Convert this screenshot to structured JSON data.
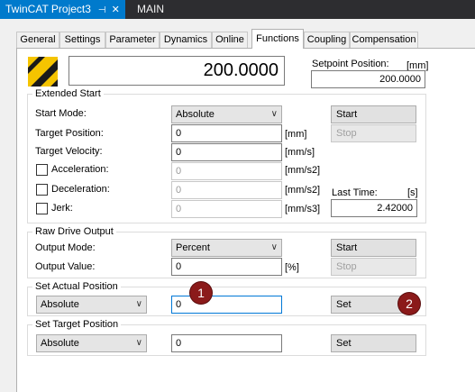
{
  "doc_tabs": [
    {
      "label": "TwinCAT Project3",
      "pin": "⊣",
      "close": "✕"
    },
    {
      "label": "MAIN"
    }
  ],
  "tabs": [
    "General",
    "Settings",
    "Parameter",
    "Dynamics",
    "Online",
    "Functions",
    "Coupling",
    "Compensation"
  ],
  "selected_tab": "Functions",
  "display": {
    "value": "200.0000"
  },
  "setpoint": {
    "label": "Setpoint Position:",
    "unit": "[mm]",
    "value": "200.0000"
  },
  "extended_start": {
    "title": "Extended Start",
    "start_mode_label": "Start Mode:",
    "start_mode_value": "Absolute",
    "start_button": "Start",
    "target_position_label": "Target Position:",
    "target_position_value": "0",
    "target_position_unit": "[mm]",
    "stop_button": "Stop",
    "target_velocity_label": "Target Velocity:",
    "target_velocity_value": "0",
    "target_velocity_unit": "[mm/s]",
    "acceleration_label": "Acceleration:",
    "acceleration_value": "0",
    "acceleration_unit": "[mm/s2]",
    "deceleration_label": "Deceleration:",
    "deceleration_value": "0",
    "deceleration_unit": "[mm/s2]",
    "jerk_label": "Jerk:",
    "jerk_value": "0",
    "jerk_unit": "[mm/s3]",
    "last_time_label": "Last Time:",
    "last_time_unit": "[s]",
    "last_time_value": "2.42000"
  },
  "raw_drive": {
    "title": "Raw Drive Output",
    "output_mode_label": "Output Mode:",
    "output_mode_value": "Percent",
    "start_button": "Start",
    "output_value_label": "Output Value:",
    "output_value": "0",
    "output_unit": "[%]",
    "stop_button": "Stop"
  },
  "set_actual": {
    "title": "Set Actual Position",
    "mode_value": "Absolute",
    "value": "0",
    "set_button": "Set"
  },
  "set_target": {
    "title": "Set Target Position",
    "mode_value": "Absolute",
    "value": "0",
    "set_button": "Set"
  },
  "markers": [
    "1",
    "2"
  ],
  "icons": {
    "motor": "motor-status-icon",
    "chevron": "chevron-down-icon"
  },
  "colors": {
    "titlebar": "#2d2d30",
    "active_doc_tab": "#007acc",
    "marker": "#8b1a1a"
  }
}
